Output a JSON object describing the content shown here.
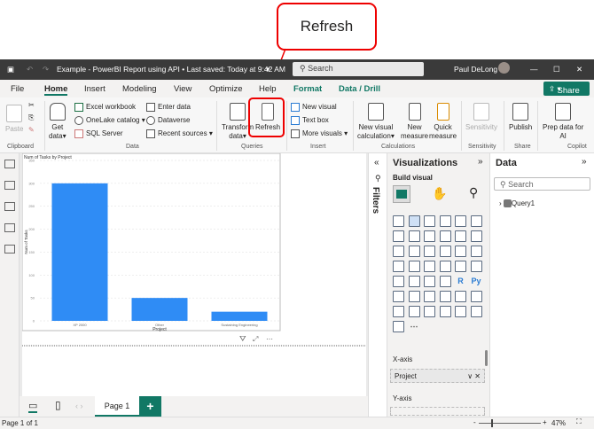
{
  "callout": {
    "label": "Refresh",
    "color": "#e00000"
  },
  "titlebar": {
    "title": "Example - PowerBI Report using API • Last saved: Today at 9:42 AM",
    "search_placeholder": "Search",
    "user": "Paul DeLong"
  },
  "menu": {
    "tabs": [
      "File",
      "Home",
      "Insert",
      "Modeling",
      "View",
      "Optimize",
      "Help",
      "Format",
      "Data / Drill"
    ],
    "active": "Home",
    "share": "Share"
  },
  "ribbon": {
    "clipboard": {
      "paste": "Paste",
      "group": "Clipboard"
    },
    "data": {
      "get_data": "Get",
      "get_data2": "data",
      "excel": "Excel workbook",
      "onelake": "OneLake catalog",
      "sql": "SQL Server",
      "enter": "Enter data",
      "dataverse": "Dataverse",
      "recent": "Recent sources",
      "group": "Data"
    },
    "queries": {
      "transform": "Transform",
      "transform2": "data",
      "refresh": "Refresh",
      "group": "Queries"
    },
    "insert": {
      "new_visual": "New visual",
      "text_box": "Text box",
      "more_visuals": "More visuals",
      "group": "Insert"
    },
    "calc": {
      "nvc": "New visual",
      "nvc2": "calculation",
      "nm": "New",
      "nm2": "measure",
      "qm": "Quick",
      "qm2": "measure",
      "group": "Calculations"
    },
    "sens": {
      "label": "Sensitivity",
      "group": "Sensitivity"
    },
    "share": {
      "publish": "Publish",
      "group": "Share"
    },
    "copilot": {
      "prep": "Prep data for",
      "prep2": "AI",
      "group": "Copilot"
    }
  },
  "chart_data": {
    "type": "bar",
    "title": "Num of Tasks by Project",
    "xlabel": "Project",
    "ylabel": "Num of Tasks",
    "categories": [
      "XP 2000",
      "Other",
      "Sustaining Engineering"
    ],
    "values": [
      300,
      50,
      20
    ],
    "ylim": [
      0,
      350
    ],
    "yticks": [
      0,
      50,
      100,
      150,
      200,
      250,
      300,
      350
    ],
    "grid": true,
    "color": "#2f8cf5"
  },
  "filters": {
    "label": "Filters"
  },
  "viz": {
    "title": "Visualizations",
    "build": "Build visual",
    "xaxis": "X-axis",
    "xfield": "Project",
    "yaxis": "Y-axis",
    "more": "⋯"
  },
  "datapane": {
    "title": "Data",
    "search_placeholder": "Search",
    "table": "Query1"
  },
  "pages": {
    "tab": "Page 1",
    "add": "+"
  },
  "status": {
    "page": "Page 1 of 1",
    "zoom": "47%"
  }
}
